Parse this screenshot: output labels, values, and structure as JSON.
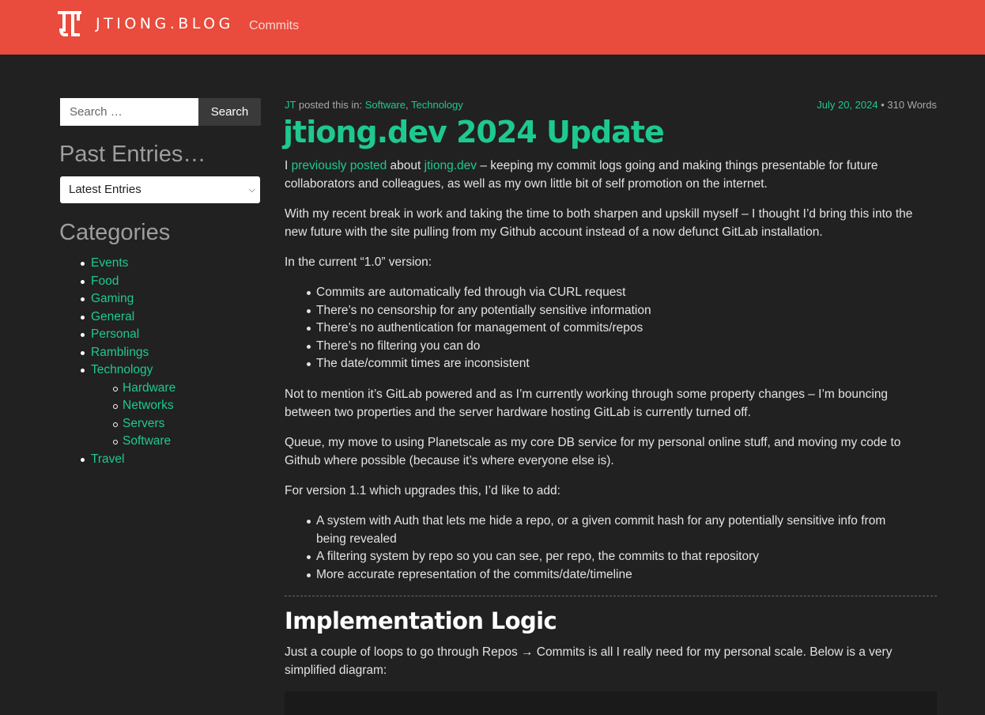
{
  "header": {
    "brand": "JTIONG.BLOG",
    "nav": [
      "Commits"
    ],
    "colors": {
      "bar": "#e94b3c",
      "accent": "#1ec98f"
    }
  },
  "sidebar": {
    "search": {
      "placeholder": "Search …",
      "button": "Search"
    },
    "past_entries": {
      "heading": "Past Entries…",
      "selected": "Latest Entries"
    },
    "categories": {
      "heading": "Categories",
      "items": [
        "Events",
        "Food",
        "Gaming",
        "General",
        "Personal",
        "Ramblings",
        "Technology"
      ],
      "technology_children": [
        "Hardware",
        "Networks",
        "Servers",
        "Software"
      ],
      "last": "Travel"
    }
  },
  "post": {
    "author": "JT",
    "posted_in": "posted this in:",
    "categories": [
      "Software",
      "Technology"
    ],
    "date": "July 20, 2024",
    "words": "• 310 Words",
    "title": "jtiong.dev 2024 Update",
    "p1": {
      "a": "I ",
      "link1": "previously posted",
      "b": " about ",
      "link2": "jtiong.dev",
      "c": " – keeping my commit logs going and making things presentable for future collaborators and colleagues, as well as my own little bit of self promotion on the internet."
    },
    "p2": "With my recent break in work and taking the time to both sharpen and upskill myself – I thought I’d bring this into the new future with the site pulling from my Github account instead of a now defunct GitLab installation.",
    "p3": "In the current “1.0” version:",
    "list1": [
      "Commits are automatically fed through via CURL request",
      "There’s no censorship for any potentially sensitive information",
      "There’s no authentication for management of commits/repos",
      "There’s no filtering you can do",
      "The date/commit times are inconsistent"
    ],
    "p4": "Not to mention it’s GitLab powered and as I’m currently working through some property changes – I’m bouncing between two properties and the server hardware hosting GitLab is currently turned off.",
    "p5": "Queue, my move to using Planetscale as my core DB service for my personal online stuff, and moving my code to Github where possible (because it’s where everyone else is).",
    "p6": "For version 1.1 which upgrades this, I’d like to add:",
    "list2": [
      "A system with Auth that lets me hide a repo, or a given commit hash for any potentially sensitive info from being revealed",
      "A filtering system by repo so you can see, per repo, the commits to that repository",
      "More accurate representation of the commits/date/timeline"
    ],
    "h2": "Implementation Logic",
    "p7": "Just a couple of loops to go through Repos → Commits is all I really need for my personal scale. Below is a very simplified diagram:"
  }
}
